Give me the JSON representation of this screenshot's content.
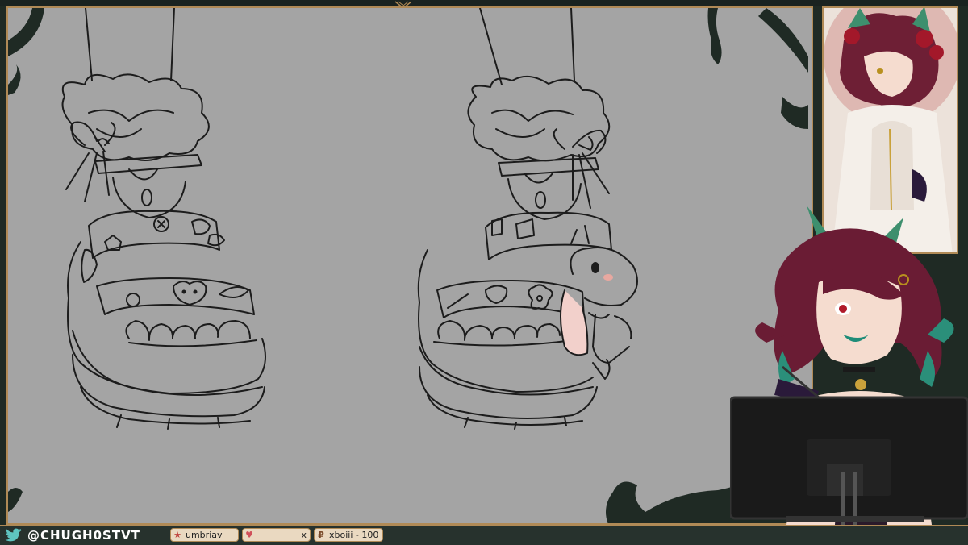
{
  "overlay": {
    "social_handle": "@CHUGH0STVT",
    "social_icon": "twitter-bird-icon"
  },
  "alerts": {
    "follower": {
      "icon": "star-icon",
      "name": "umbriav"
    },
    "subscriber": {
      "icon": "heart-icon",
      "name": "",
      "trailing": "x"
    },
    "donation": {
      "icon": "currency-icon",
      "text": "xboiii - 100"
    }
  },
  "colors": {
    "frame_gold": "#b08a56",
    "bar_dark": "#27322d",
    "canvas_gray": "#a4a4a4",
    "pill_bg": "#ead9c1",
    "twitter_teal": "#5fc4c0"
  }
}
